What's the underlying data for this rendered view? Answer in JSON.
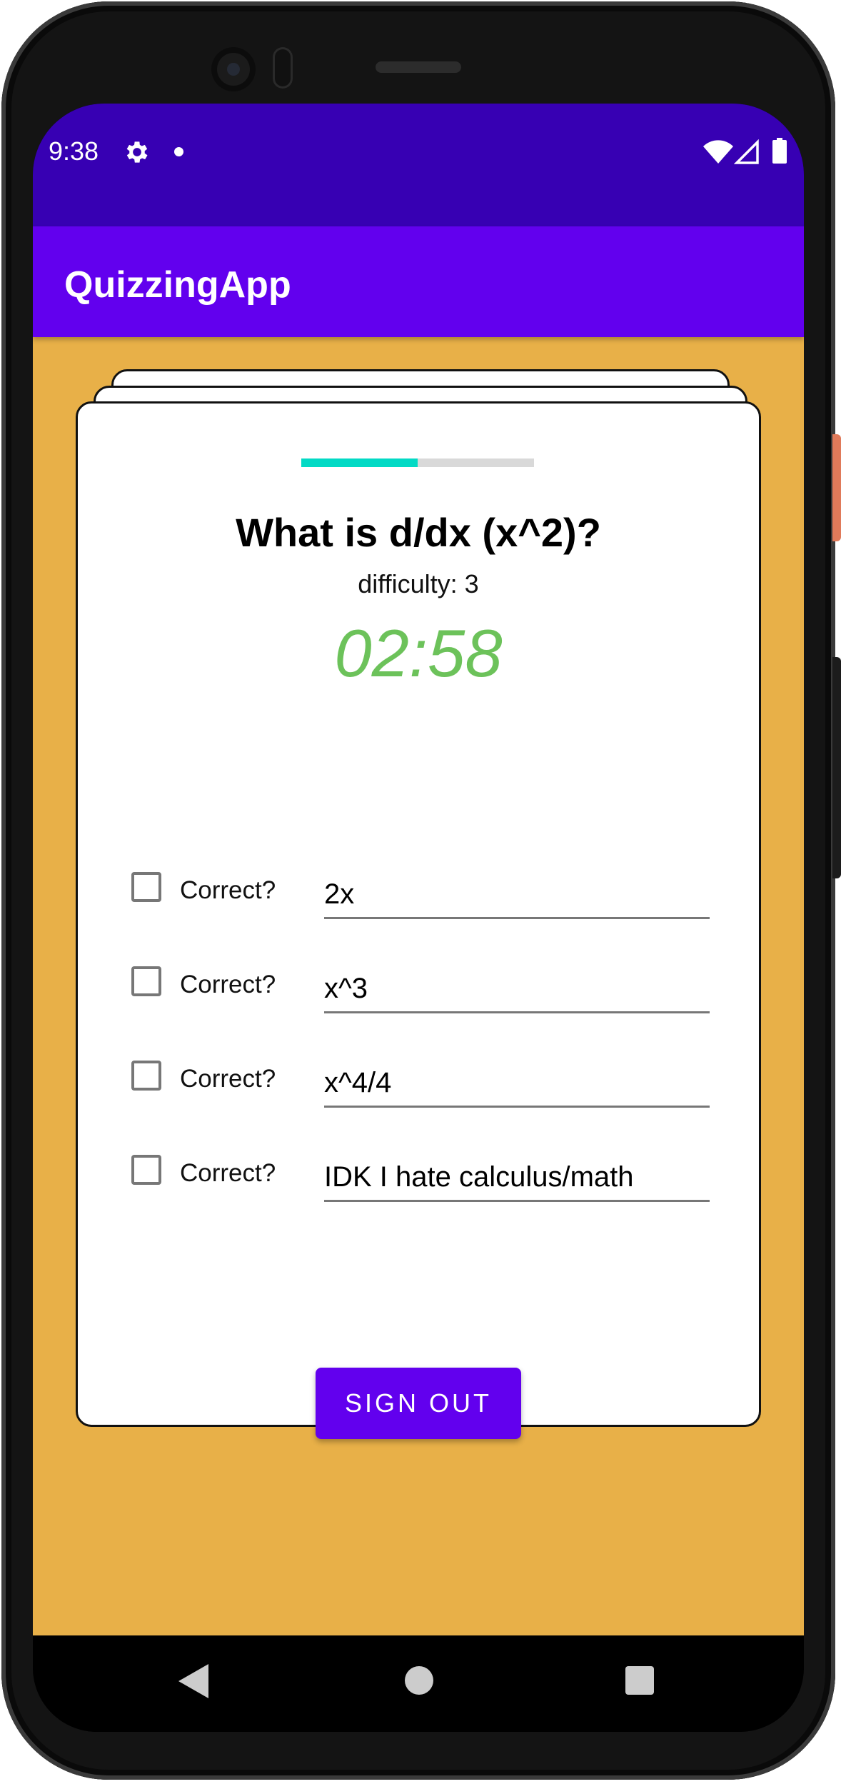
{
  "status_bar": {
    "time": "9:38"
  },
  "app_bar": {
    "title": "QuizzingApp"
  },
  "quiz": {
    "progress": 0.5,
    "question": "What is d/dx (x^2)?",
    "difficulty": "difficulty: 3",
    "timer": "02:58",
    "timer_color": "#6cc25a",
    "answers": [
      {
        "correct_label": "Correct?",
        "checked": false,
        "value": "2x"
      },
      {
        "correct_label": "Correct?",
        "checked": false,
        "value": "x^3"
      },
      {
        "correct_label": "Correct?",
        "checked": false,
        "value": "x^4/4"
      },
      {
        "correct_label": "Correct?",
        "checked": false,
        "value": "IDK I hate calculus/math"
      }
    ]
  },
  "sign_out_label": "SIGN OUT",
  "colors": {
    "status_bar": "#3700b3",
    "app_bar": "#6200ee",
    "background": "#e8b048",
    "progress": "#03dac5",
    "button": "#6200ee"
  },
  "icons": {
    "status": [
      "gear-icon",
      "dot-icon",
      "wifi-icon",
      "signal-icon",
      "battery-icon"
    ],
    "nav": [
      "back-icon",
      "home-icon",
      "recents-icon"
    ]
  }
}
